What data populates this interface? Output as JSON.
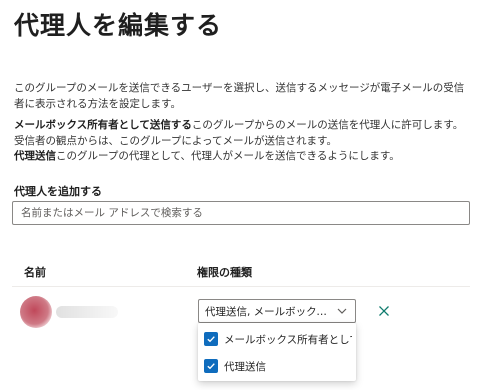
{
  "header": {
    "title": "代理人を編集する"
  },
  "description": {
    "intro": "このグループのメールを送信できるユーザーを選択し、送信するメッセージが電子メールの受信者に表示される方法を設定します。",
    "send_as_term": "メールボックス所有者として送信する",
    "send_as_text": "このグループからのメールの送信を代理人に許可します。受信者の観点からは、このグループによってメールが送信されます。",
    "send_on_behalf_term": "代理送信",
    "send_on_behalf_text": "このグループの代理として、代理人がメールを送信できるようにします。"
  },
  "add_delegate": {
    "label": "代理人を追加する",
    "placeholder": "名前またはメール アドレスで検索する",
    "value": ""
  },
  "table": {
    "headers": [
      "名前",
      "権限の種類"
    ],
    "rows": [
      {
        "permission_display": "代理送信, メールボックス所..."
      }
    ]
  },
  "permission_menu": {
    "options": [
      {
        "label": "メールボックス所有者として送...",
        "checked": true
      },
      {
        "label": "代理送信",
        "checked": true
      }
    ]
  },
  "icons": {
    "dropdown": "chevron-down-icon",
    "remove": "close-icon",
    "checkbox": "checkmark-icon"
  },
  "colors": {
    "accent": "#0f6cbd",
    "remove_icon": "#107c6e"
  }
}
